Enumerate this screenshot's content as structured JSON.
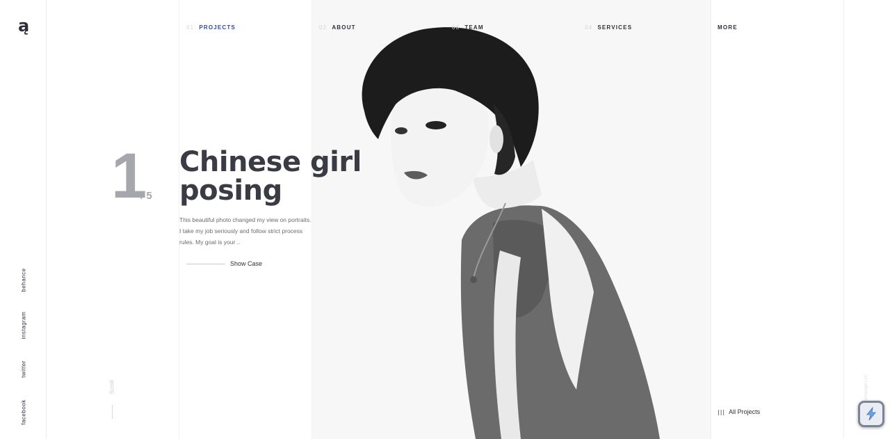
{
  "brand": {
    "logo_text": "ą"
  },
  "nav": [
    {
      "num": "01",
      "label": "PROJECTS",
      "active": true
    },
    {
      "num": "02",
      "label": "ABOUT"
    },
    {
      "num": "03",
      "label": "TEAM"
    },
    {
      "num": "04",
      "label": "SERVICES"
    },
    {
      "num": "",
      "label": "MORE"
    }
  ],
  "social": [
    "behance",
    "instagram",
    "twitter",
    "facebook"
  ],
  "slide": {
    "current": "1",
    "total": "/ 5",
    "title": "Chinese girl posing",
    "description": "This beautiful photo changed my view on portraits. I take my job seriously and follow strict process rules. My goal is your ..",
    "cta": "Show Case"
  },
  "scroll_label": "Scroll",
  "all_projects": {
    "icon": "grid-icon",
    "label": "All Projects"
  },
  "copyright": "Ramonage LLC",
  "colors": {
    "accent": "#2c4a9a",
    "text": "#2e2f38",
    "muted": "#a6a7ad",
    "panel": "#f7f7f7"
  }
}
